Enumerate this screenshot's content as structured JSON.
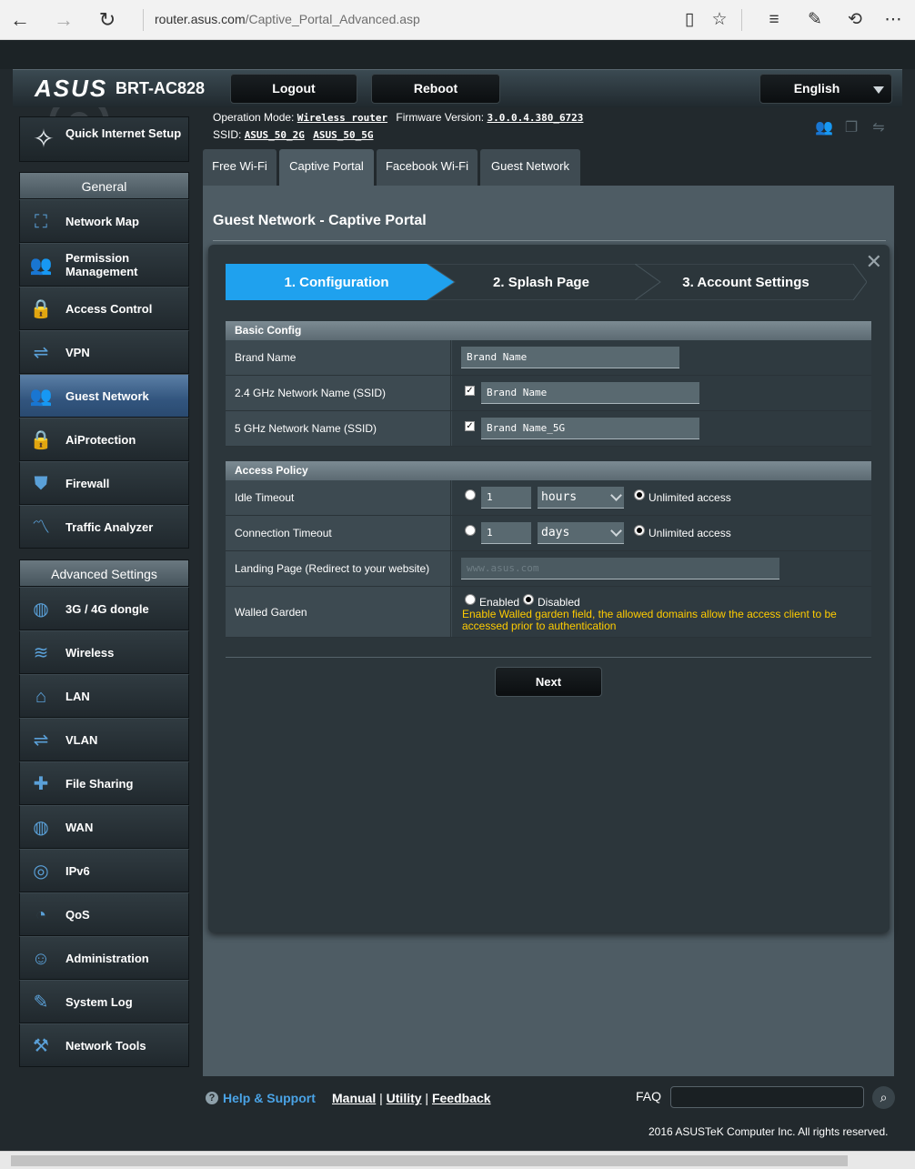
{
  "browser": {
    "url_host": "router.asus.com",
    "url_path": "/Captive_Portal_Advanced.asp"
  },
  "header": {
    "logo": "ASUS",
    "model": "BRT-AC828",
    "logout_label": "Logout",
    "reboot_label": "Reboot",
    "language": "English"
  },
  "info": {
    "operation_mode_label": "Operation Mode:",
    "operation_mode_value": "Wireless router",
    "firmware_label": "Firmware Version:",
    "firmware_value": "3.0.0.4.380_6723",
    "ssid_label": "SSID:",
    "ssid_values": [
      "ASUS_50_2G",
      "ASUS_50_5G"
    ]
  },
  "sidebar": {
    "quick_setup": "Quick Internet Setup",
    "general_header": "General",
    "general_items": [
      {
        "label": "Network Map",
        "icon": "network-map-icon",
        "glyph": "⛶"
      },
      {
        "label": "Permission Management",
        "icon": "users-icon",
        "glyph": "👥"
      },
      {
        "label": "Access Control",
        "icon": "lock-icon",
        "glyph": "🔒"
      },
      {
        "label": "VPN",
        "icon": "vpn-icon",
        "glyph": "⇌"
      },
      {
        "label": "Guest Network",
        "icon": "guest-icon",
        "glyph": "👥"
      },
      {
        "label": "AiProtection",
        "icon": "lock-icon",
        "glyph": "🔒"
      },
      {
        "label": "Firewall",
        "icon": "shield-icon",
        "glyph": "⛊"
      },
      {
        "label": "Traffic Analyzer",
        "icon": "chart-icon",
        "glyph": "〽"
      }
    ],
    "advanced_header": "Advanced Settings",
    "advanced_items": [
      {
        "label": "3G / 4G dongle",
        "icon": "globe-icon",
        "glyph": "◍"
      },
      {
        "label": "Wireless",
        "icon": "wifi-icon",
        "glyph": "≋"
      },
      {
        "label": "LAN",
        "icon": "home-icon",
        "glyph": "⌂"
      },
      {
        "label": "VLAN",
        "icon": "vlan-icon",
        "glyph": "⇌"
      },
      {
        "label": "File Sharing",
        "icon": "puzzle-icon",
        "glyph": "✚"
      },
      {
        "label": "WAN",
        "icon": "globe-icon",
        "glyph": "◍"
      },
      {
        "label": "IPv6",
        "icon": "ipv6-icon",
        "glyph": "◎"
      },
      {
        "label": "QoS",
        "icon": "gauge-icon",
        "glyph": "◔"
      },
      {
        "label": "Administration",
        "icon": "admin-icon",
        "glyph": "☺"
      },
      {
        "label": "System Log",
        "icon": "log-icon",
        "glyph": "✎"
      },
      {
        "label": "Network Tools",
        "icon": "tools-icon",
        "glyph": "⚒"
      }
    ]
  },
  "tabs": [
    "Free Wi-Fi",
    "Captive Portal",
    "Facebook Wi-Fi",
    "Guest Network"
  ],
  "main": {
    "title": "Guest Network - Captive Portal",
    "steps": [
      "1. Configuration",
      "2. Splash Page",
      "3. Account Settings"
    ],
    "basic_config": {
      "header": "Basic Config",
      "brand_name_label": "Brand Name",
      "brand_name_value": "Brand Name",
      "ssid24_label": "2.4 GHz Network Name (SSID)",
      "ssid24_value": "Brand Name",
      "ssid5_label": "5 GHz Network Name (SSID)",
      "ssid5_value": "Brand Name_5G"
    },
    "access_policy": {
      "header": "Access Policy",
      "idle_label": "Idle Timeout",
      "idle_value": "1",
      "idle_unit": "hours",
      "conn_label": "Connection Timeout",
      "conn_value": "1",
      "conn_unit": "days",
      "unlimited_label": "Unlimited access",
      "landing_label": "Landing Page (Redirect to your website)",
      "landing_placeholder": "www.asus.com",
      "walled_label": "Walled Garden",
      "enabled_label": "Enabled",
      "disabled_label": "Disabled",
      "walled_note": "Enable Walled garden field, the allowed domains allow the access client to be accessed prior to authentication"
    },
    "next_label": "Next"
  },
  "footer": {
    "help": "Help & Support",
    "manual": "Manual",
    "utility": "Utility",
    "feedback": "Feedback",
    "faq": "FAQ",
    "copyright": "2016 ASUSTeK Computer Inc. All rights reserved."
  }
}
